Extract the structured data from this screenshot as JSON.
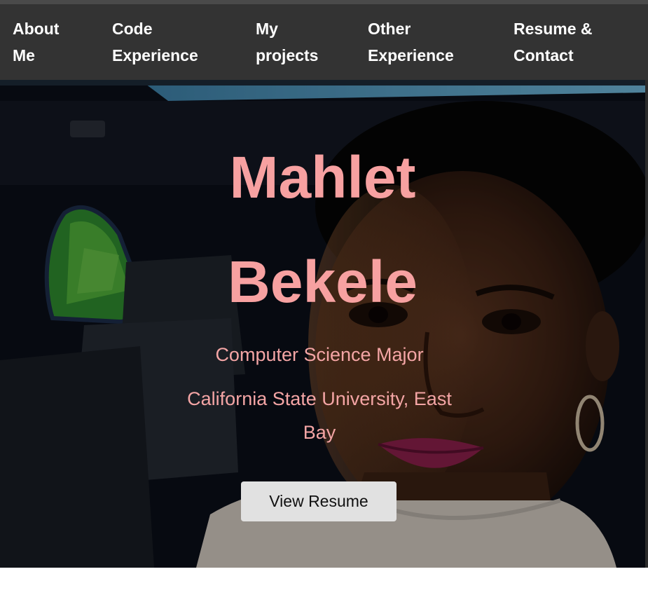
{
  "nav": {
    "items": [
      {
        "line1": "About",
        "line2": "Me"
      },
      {
        "line1": "Code",
        "line2": "Experience"
      },
      {
        "line1": "My",
        "line2": "projects"
      },
      {
        "line1": "Other",
        "line2": "Experience"
      },
      {
        "line1": "Resume &",
        "line2": "Contact"
      }
    ]
  },
  "hero": {
    "first_name": "Mahlet",
    "last_name": "Bekele",
    "major": "Computer Science Major",
    "university_line1": "California State University, East",
    "university_line2": "Bay",
    "button_label": "View Resume"
  },
  "colors": {
    "nav_bg": "#333333",
    "accent_pink": "#f7a1a1",
    "button_bg": "#e1e1e1"
  }
}
